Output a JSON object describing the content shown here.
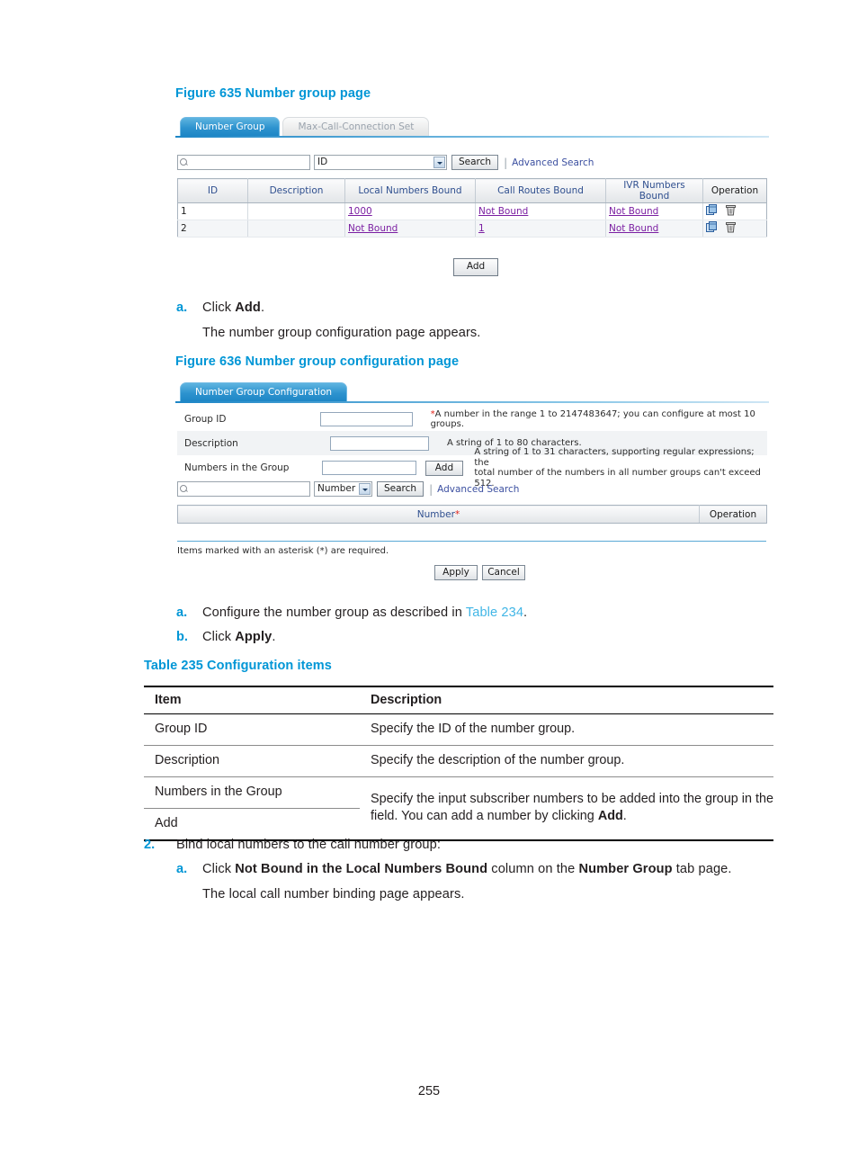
{
  "figure635": {
    "caption": "Figure 635 Number group page",
    "tabs": [
      {
        "label": "Number Group",
        "active": true
      },
      {
        "label": "Max-Call-Connection Set",
        "active": false
      }
    ],
    "search": {
      "input_value": "",
      "select_value": "ID",
      "search_button": "Search",
      "advanced_link": "Advanced Search"
    },
    "table": {
      "headers": [
        "ID",
        "Description",
        "Local Numbers Bound",
        "Call Routes Bound",
        "IVR Numbers Bound",
        "Operation"
      ],
      "rows": [
        {
          "id": "1",
          "description": "",
          "local_numbers_bound": "1000",
          "call_routes_bound": "Not Bound",
          "ivr_numbers_bound": "Not Bound"
        },
        {
          "id": "2",
          "description": "",
          "local_numbers_bound": "Not Bound",
          "call_routes_bound": "1",
          "ivr_numbers_bound": "Not Bound"
        }
      ]
    },
    "add_button": "Add"
  },
  "step_a1": {
    "marker": "a.",
    "line1_pre": "Click ",
    "line1_bold": "Add",
    "line1_post": ".",
    "line2": "The number group configuration page appears."
  },
  "figure636": {
    "caption": "Figure 636 Number group configuration page",
    "tab_label": "Number Group Configuration",
    "fields": [
      {
        "label": "Group ID",
        "value": "",
        "hint_required": "*",
        "hint": "A number in the range 1 to 2147483647; you can configure at most 10 groups."
      },
      {
        "label": "Description",
        "value": "",
        "hint_required": "",
        "hint": "A string of 1 to 80 characters."
      },
      {
        "label": "Numbers in the Group",
        "value": "",
        "hint_required": "",
        "hint_line1": "A string of 1 to 31 characters, supporting regular expressions; the",
        "hint_line2": "total number of the numbers in all number groups can't exceed 512.",
        "add_button": "Add"
      }
    ],
    "search": {
      "input_value": "",
      "select_value": "Number",
      "search_button": "Search",
      "advanced_link": "Advanced Search"
    },
    "inner_table_headers": [
      "Number",
      "Operation"
    ],
    "inner_table_required_mark": "*",
    "footnote": "Items marked with an asterisk (*) are required.",
    "apply_button": "Apply",
    "cancel_button": "Cancel"
  },
  "step_a2": {
    "marker": "a.",
    "pre": "Configure the number group as described in ",
    "xref": "Table 234",
    "post": "."
  },
  "step_b2": {
    "marker": "b.",
    "pre": "Click ",
    "bold": "Apply",
    "post": "."
  },
  "table235": {
    "caption": "Table 235 Configuration items",
    "headers": [
      "Item",
      "Description"
    ],
    "rows": [
      {
        "item": "Group ID",
        "description": "Specify the ID of the number group."
      },
      {
        "item": "Description",
        "description": "Specify the description of the number group."
      },
      {
        "item": "Numbers in the Group",
        "description_line1": "Specify the input subscriber numbers to be added into the group in the",
        "description_line2_pre": "field. You can add a number by clicking ",
        "description_line2_bold": "Add",
        "description_line2_post": "."
      },
      {
        "item": "Add"
      }
    ]
  },
  "step2": {
    "marker": "2.",
    "text": "Bind local numbers to the call number group:",
    "sub_marker": "a.",
    "sub_pre": "Click ",
    "sub_bold1": "Not Bound in the Local Numbers Bound",
    "sub_mid": " column on the ",
    "sub_bold2": "Number Group",
    "sub_post": " tab page.",
    "sub_line2": "The local call number binding page appears."
  },
  "page_number": "255",
  "colors": {
    "caption_blue": "#0096d6",
    "xref_blue": "#41b6e6",
    "tab_active": "#1d86c6",
    "link_purple": "#7b1fa2",
    "required_red": "#e2231a",
    "header_text_blue": "#2f4f8f"
  }
}
